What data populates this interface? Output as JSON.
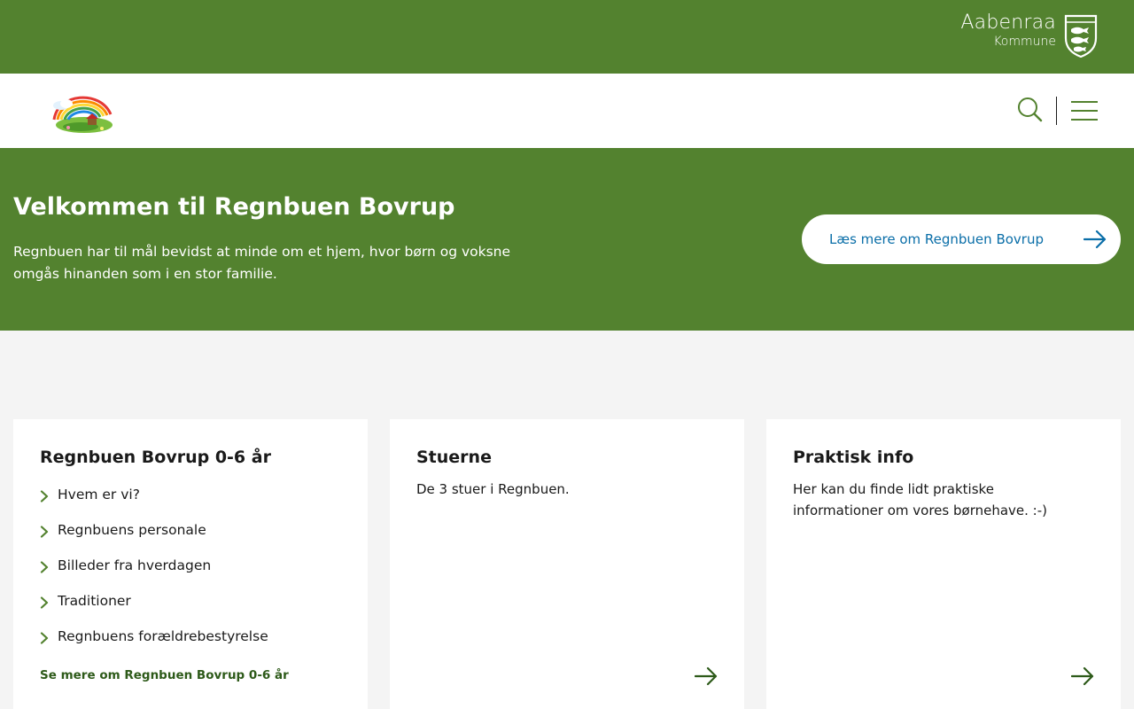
{
  "header": {
    "brand_name": "Aabenraa",
    "brand_sub": "Kommune",
    "brand_color": "#53822f",
    "icons": {
      "coat_of_arms": "shield-crest-icon",
      "search": "search-icon",
      "menu": "hamburger-menu-icon"
    }
  },
  "hero": {
    "title": "Velkommen til Regnbuen Bovrup",
    "text": "Regnbuen har til mål bevidst at minde om et hjem, hvor børn og voksne omgås hinanden som i en stor familie.",
    "cta_label": "Læs mere om Regnbuen Bovrup",
    "cta_color": "#0a6ea8"
  },
  "cards": [
    {
      "title": "Regnbuen Bovrup 0-6 år",
      "items": [
        {
          "label": "Hvem er vi?"
        },
        {
          "label": "Regnbuens personale"
        },
        {
          "label": "Billeder fra hverdagen"
        },
        {
          "label": "Traditioner"
        },
        {
          "label": "Regnbuens forældrebestyrelse"
        }
      ],
      "link_label": "Se mere om Regnbuen Bovrup 0-6 år"
    },
    {
      "title": "Stuerne",
      "description": "De 3 stuer i Regnbuen."
    },
    {
      "title": "Praktisk info",
      "description": "Her kan du finde lidt praktiske informationer om vores børnehave. :-)"
    }
  ]
}
